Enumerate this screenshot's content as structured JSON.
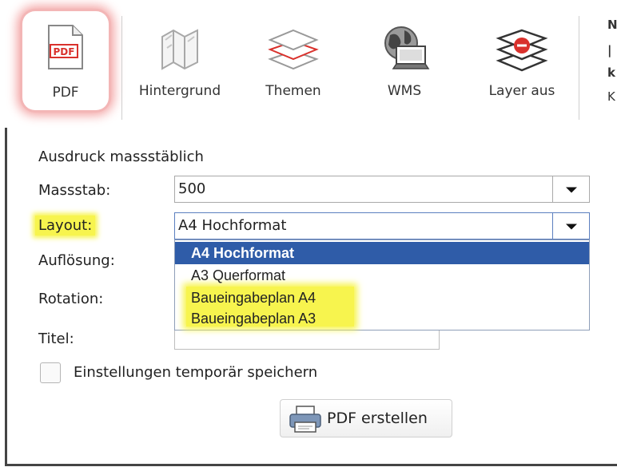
{
  "toolbar": {
    "tools": [
      {
        "label": "PDF",
        "icon": "pdf-icon",
        "active": true
      },
      {
        "label": "Hintergrund",
        "icon": "map-fold-icon"
      },
      {
        "label": "Themen",
        "icon": "layers-icon"
      },
      {
        "label": "WMS",
        "icon": "globe-computer-icon"
      },
      {
        "label": "Layer aus",
        "icon": "layers-off-icon"
      }
    ],
    "pdf_icon_text": "PDF"
  },
  "print": {
    "section_title": "Ausdruck massstäblich",
    "scale_label": "Massstab:",
    "scale_value": "500",
    "layout_label": "Layout:",
    "layout_value": "A4 Hochformat",
    "resolution_label": "Auflösung:",
    "rotation_label": "Rotation:",
    "title_label": "Titel:",
    "title_value": "",
    "save_settings_label": "Einstellungen temporär speichern",
    "save_settings_checked": false,
    "create_button": "PDF erstellen",
    "layout_options": [
      "A4 Hochformat",
      "A3 Querformat",
      "Baueingabeplan A4",
      "Baueingabeplan A3"
    ],
    "layout_selected_index": 0
  },
  "colors": {
    "highlight": "#f7f44e",
    "selection": "#2f5ca8",
    "pdf_red": "#d9312c"
  }
}
